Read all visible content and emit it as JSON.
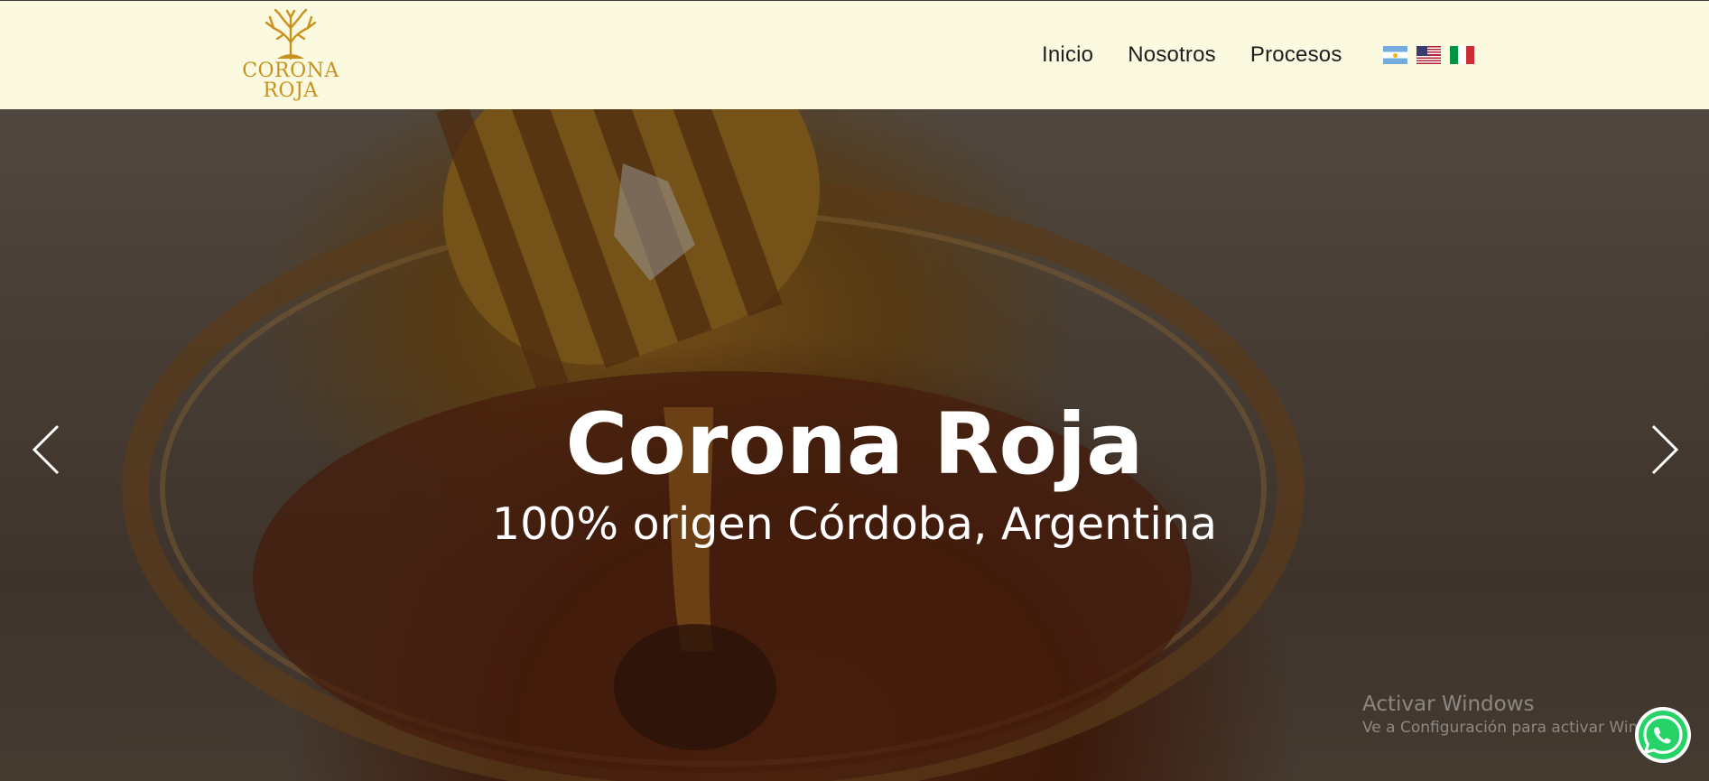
{
  "brand": {
    "logo_line1": "CORONA",
    "logo_line2": "ROJA"
  },
  "nav": {
    "items": [
      "Inicio",
      "Nosotros",
      "Procesos"
    ]
  },
  "languages": [
    {
      "code": "es-AR",
      "icon": "argentina-flag-icon"
    },
    {
      "code": "en-US",
      "icon": "usa-flag-icon"
    },
    {
      "code": "it",
      "icon": "italy-flag-icon"
    }
  ],
  "hero": {
    "title": "Corona Roja",
    "subtitle": "100% origen Córdoba, Argentina",
    "prev_icon": "chevron-left-icon",
    "next_icon": "chevron-right-icon"
  },
  "windows_activation": {
    "title": "Activar Windows",
    "message": "Ve a Configuración para activar Windows."
  },
  "floating": {
    "icon": "whatsapp-icon"
  },
  "colors": {
    "navbar_bg": "#fbf9df",
    "brand_gold": "#c8921e",
    "whatsapp_green": "#25d366"
  }
}
